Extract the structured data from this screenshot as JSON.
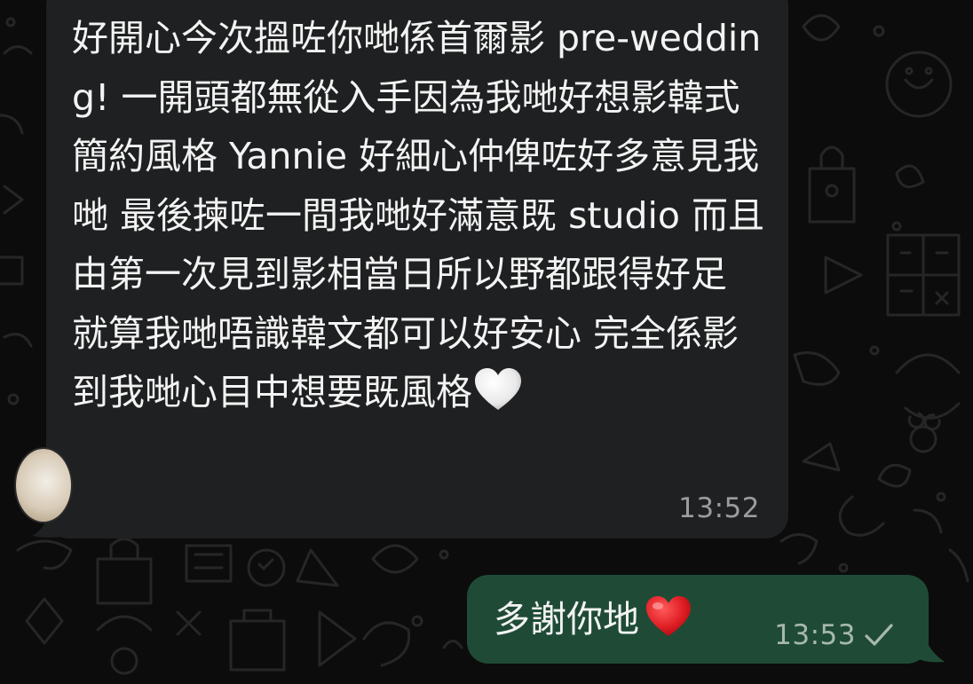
{
  "chat": {
    "incoming": {
      "text": "好開心今次搵咗你哋係首爾影 pre-wedding! 一開頭都無從入手因為我哋好想影韓式簡約風格 Yannie 好細心仲俾咗好多意見我哋 最後揀咗一間我哋好滿意既 studio 而且由第一次見到影相當日所以野都跟得好足 就算我哋唔識韓文都可以好安心 完全係影到我哋心目中想要既風格",
      "emoji": "white-heart",
      "time": "13:52"
    },
    "outgoing": {
      "text": "多謝你地",
      "emoji": "red-heart",
      "time": "13:53",
      "status_icon": "single-check-icon"
    }
  },
  "colors": {
    "background": "#0c0c0c",
    "incoming_bubble": "#1f2021",
    "outgoing_bubble": "#1f4b36",
    "text": "#f3f3f3",
    "incoming_time": "#9a9c9e",
    "outgoing_time": "#a7b8ae"
  }
}
